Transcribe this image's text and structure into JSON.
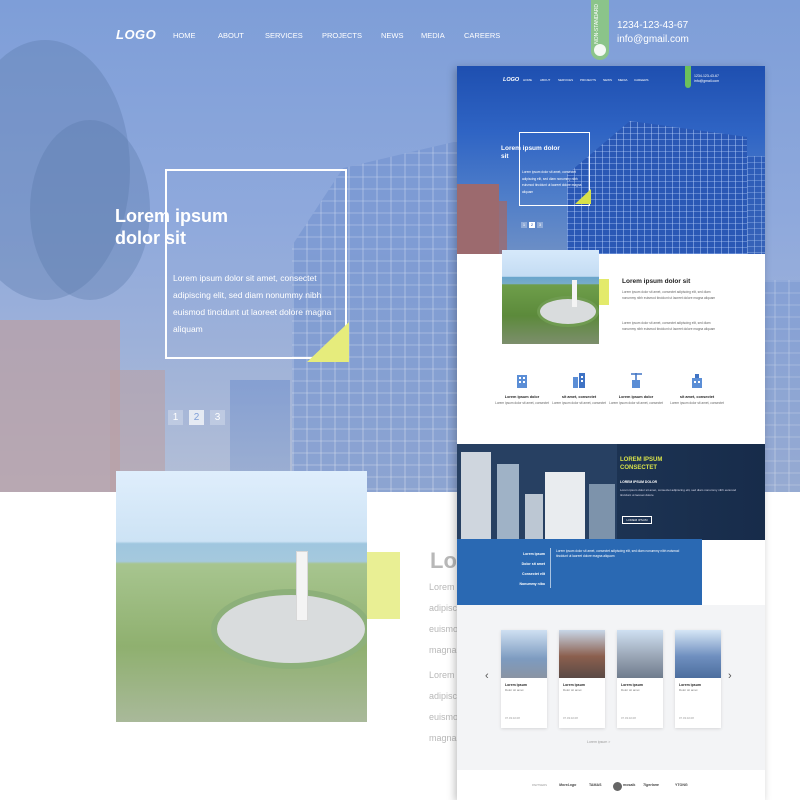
{
  "header": {
    "logo": "LOGO",
    "nav": [
      "HOME",
      "ABOUT",
      "SERVICES",
      "PROJECTS",
      "NEWS",
      "MEDIA",
      "CAREERS"
    ],
    "tag": "NON-STANDARD",
    "phone": "1234-123-43-67",
    "email": "info@gmail.com"
  },
  "hero": {
    "title": "Lorem ipsum dolor sit",
    "body": "Lorem ipsum dolor sit amet, consectet adipiscing elit, sed diam nonummy nibh euismod tincidunt ut laoreet dolore magna aliquam",
    "pages": [
      "1",
      "2",
      "3"
    ],
    "active_page": 2
  },
  "about": {
    "bg_heading": "Lor",
    "bg_lines_a": [
      "Lorem",
      "adipisc",
      "euismo",
      "magna"
    ],
    "bg_lines_b": [
      "Lorem",
      "adipisc",
      "euismo",
      "magna"
    ],
    "heading": "Lorem ipsum dolor sit",
    "para1": "Lorem ipsum dolor sit amet, consectet adipiscing elit, sed diam nonummy nibh euismod tincidunt ut laoreet dolore magna aliquam",
    "para2": "Lorem ipsum dolor sit amet, consectet adipiscing elit, sed diam nonummy nibh euismod tincidunt ut laoreet dolore magna aliquam"
  },
  "mock_header": {
    "nav": [
      "HOME",
      "ABOUT",
      "SERVICES",
      "PROJECTS",
      "NEWS",
      "MEDIA",
      "CAREERS"
    ],
    "phone": "1234-123-43-67",
    "email": "info@gmail.com"
  },
  "features": [
    {
      "icon": "building-icon",
      "title": "Lorem ipsum dolor",
      "desc": "Lorem ipsum dolor sit amet, consectet"
    },
    {
      "icon": "office-icon",
      "title": "sit amet, consectet",
      "desc": "Lorem ipsum dolor sit amet, consectet"
    },
    {
      "icon": "crane-icon",
      "title": "Lorem ipsum dolor",
      "desc": "Lorem ipsum dolor sit amet, consectet"
    },
    {
      "icon": "tower-icon",
      "title": "sit amet, consectet",
      "desc": "Lorem ipsum dolor sit amet, consectet"
    }
  ],
  "project_banner": {
    "heading_1": "LOREM IPSUM",
    "heading_2": "CONSECTET",
    "subheading": "LOREM IPSUM DOLOR",
    "body": "Lorem ipsum dolor sit amet, consectet adipiscing elit, sed diam nonummy nibh euismod tincidunt ut laoreet dolore",
    "button": "LOREM IPSUM"
  },
  "blue_panel": {
    "items": [
      "Lorem ipsum",
      "Dolor sit amet",
      "Consectet elit",
      "Nonummy nibo"
    ],
    "body": "Lorem ipsum dolor sit amet, consectet adipiscing elit, sed diam nonummy nibh euismod tincidunt ut laoreet dolore magna aliquam"
  },
  "cards": [
    {
      "title": "Lorem ipsum",
      "sub": "Dolor sit amet",
      "meta": "07.03.02.08"
    },
    {
      "title": "Lorem ipsum",
      "sub": "Dolor sit amet",
      "meta": "07.03.02.08"
    },
    {
      "title": "Lorem ipsum",
      "sub": "Dolor sit amet",
      "meta": "07.03.02.08"
    },
    {
      "title": "Lorem ipsum",
      "sub": "Dolor sit amet",
      "meta": "07.03.02.08"
    }
  ],
  "more_link": "Lorem ipsum  >",
  "partners": [
    "PARTNERS",
    "MoreLogo",
    "TAMAS",
    "mosaik",
    "Tigerlane",
    "YTONG"
  ],
  "colors": {
    "accent": "#d7e14a",
    "primary_blue": "#2a69b3",
    "hero_blue": "#1e4fb0"
  }
}
